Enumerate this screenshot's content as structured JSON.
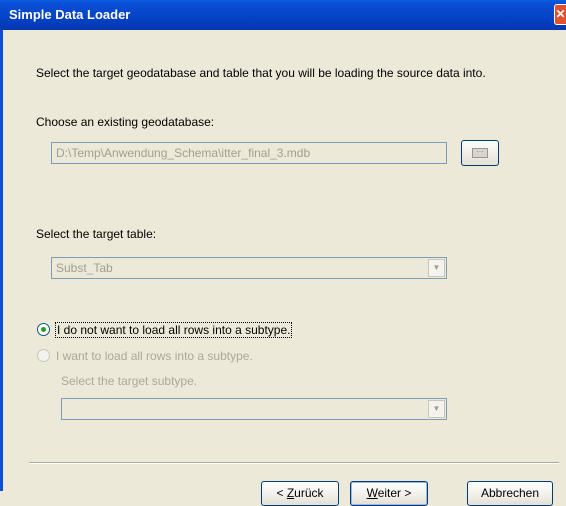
{
  "window": {
    "title": "Simple Data Loader",
    "close_glyph": "✕"
  },
  "page": {
    "description": "Select the target geodatabase and table that you will be loading the source data into.",
    "choose_gdb_label": "Choose an existing geodatabase:",
    "gdb_path": "D:\\Temp\\Anwendung_Schema\\itter_final_3.mdb",
    "browse_icon": "browse-folder-icon",
    "target_table_label": "Select the target table:",
    "target_table_value": "Subst_Tab",
    "radio_no_subtype": {
      "label": "I do not want to load all rows into a subtype.",
      "checked": true,
      "enabled": true
    },
    "radio_subtype": {
      "label": "I want to load all rows into a subtype.",
      "checked": false,
      "enabled": false
    },
    "target_subtype_label": "Select the target subtype.",
    "target_subtype_value": ""
  },
  "buttons": {
    "back_prefix": "< ",
    "back_accel": "Z",
    "back_rest": "urück",
    "next_accel": "W",
    "next_rest": "eiter >",
    "cancel": "Abbrechen"
  },
  "colors": {
    "titlebar": "#0a4fd6",
    "dialog_bg": "#ece9d8",
    "disabled_text": "#aca899",
    "button_border": "#003c74"
  }
}
